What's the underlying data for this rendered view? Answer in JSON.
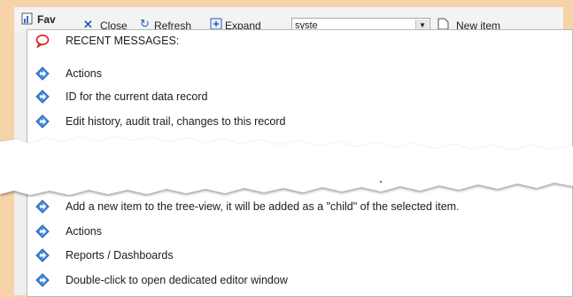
{
  "toolbar": {
    "favorites_label": "Fav",
    "close_label": "Close",
    "refresh_label": "Refresh",
    "expand_label": "Expand",
    "search_value": "syste",
    "new_item_label": "New item"
  },
  "messages": {
    "header": "RECENT MESSAGES:",
    "items_top": [
      "Actions",
      "ID for the current data record",
      "Edit history, audit trail, changes to this record"
    ],
    "items_bottom": [
      "Add a new item to the tree-view, it will be added as a \"child\" of the selected item.",
      "Actions",
      "Reports / Dashboards",
      "Double-click to open dedicated editor window"
    ]
  },
  "colors": {
    "background": "#f6d3a9",
    "header_icon": "#d92020",
    "item_icon": "#2f7fd6"
  }
}
